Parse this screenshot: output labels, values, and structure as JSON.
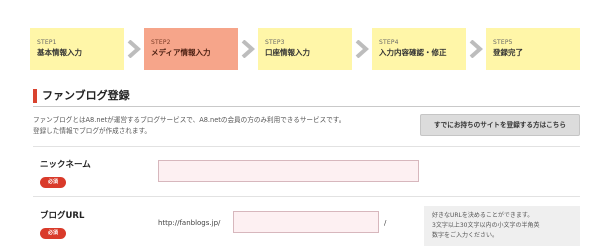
{
  "steps": [
    {
      "no": "STEP1",
      "name": "基本情報入力",
      "active": false
    },
    {
      "no": "STEP2",
      "name": "メディア情報入力",
      "active": true
    },
    {
      "no": "STEP3",
      "name": "口座情報入力",
      "active": false
    },
    {
      "no": "STEP4",
      "name": "入力内容確認・修正",
      "active": false
    },
    {
      "no": "STEP5",
      "name": "登録完了",
      "active": false
    }
  ],
  "colors": {
    "step_bg": "#fff6a8",
    "step_active_bg": "#f6a58a",
    "arrow": "#bdbdbd",
    "accent_red": "#d9432f",
    "required_badge": "#d93a2a",
    "input_bg": "#fdf0f2"
  },
  "section": {
    "title": "ファンブログ登録",
    "description_line1": "ファンブログとはA8.netが運営するブログサービスで、A8.netの会員の方のみ利用できるサービスです。",
    "description_line2": "登録した情報でブログが作成されます。",
    "existing_site_button": "すでにお持ちのサイトを登録する方はこちら"
  },
  "form": {
    "required_label": "必須",
    "nickname": {
      "label": "ニックネーム",
      "value": "",
      "placeholder": ""
    },
    "blog_url": {
      "label": "ブログURL",
      "prefix": "http://fanblogs.jp/",
      "suffix": "/",
      "value": "",
      "placeholder": "",
      "hint_line1": "好きなURLを決めることができます。",
      "hint_line2": "3文字以上30文字以内の小文字の半角英",
      "hint_line3": "数字をご入力ください。"
    }
  },
  "icons": {
    "step_arrow": "chevron-right-icon",
    "section_marker": "red-bar"
  }
}
